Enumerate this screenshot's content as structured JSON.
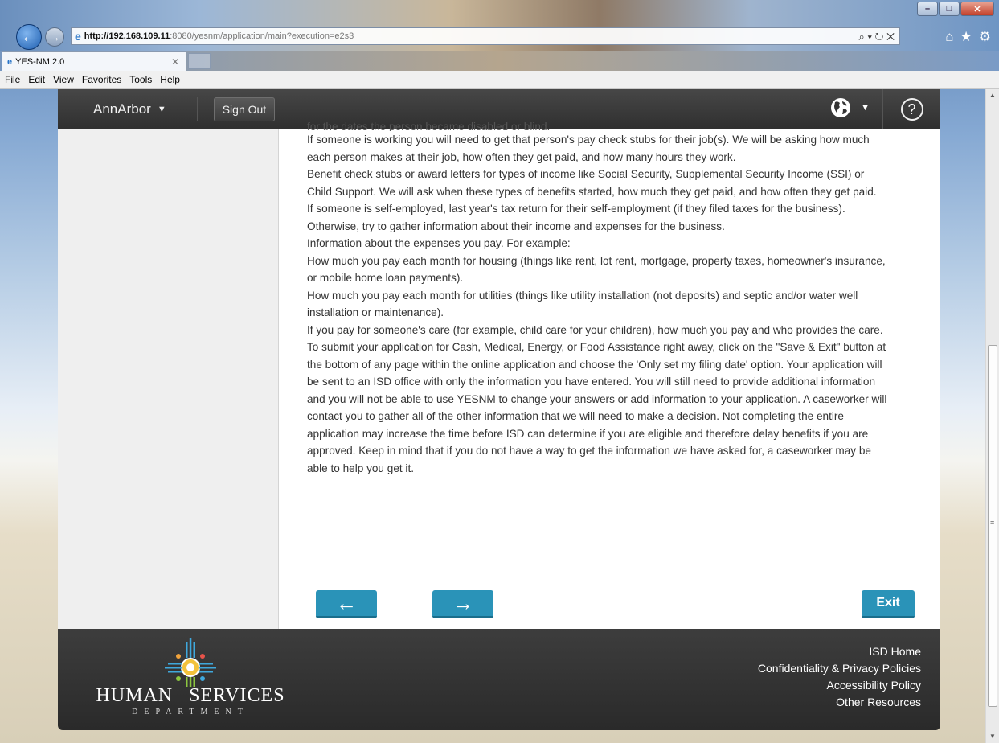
{
  "browser": {
    "url_host": "http://192.168.109.11",
    "url_rest": ":8080/yesnm/application/main?execution=e2s3",
    "tab_title": "YES-NM 2.0",
    "menu": [
      "File",
      "Edit",
      "View",
      "Favorites",
      "Tools",
      "Help"
    ],
    "addr_tools": "⌕ ▾ ↻ ✕",
    "nav_icons": [
      "⌂",
      "★",
      "⚙"
    ]
  },
  "header": {
    "user_name": "AnnArbor",
    "sign_out_label": "Sign Out",
    "help_label": "?"
  },
  "content": {
    "cut_line": "for the dates the person became disabled or blind.",
    "paragraphs": [
      "If someone is working you will need to get that person's pay check stubs for their job(s). We will be asking how much each person makes at their job, how often they get paid, and how many hours they work.",
      "Benefit check stubs or award letters for types of income like Social Security, Supplemental Security Income (SSI) or Child Support. We will ask when these types of benefits started, how much they get paid, and how often they get paid.",
      "If someone is self-employed, last year's tax return for their self-employment (if they filed taxes for the business). Otherwise, try to gather information about their income and expenses for the business.",
      "Information about the expenses you pay. For example:",
      "How much you pay each month for housing (things like rent, lot rent, mortgage, property taxes, homeowner's insurance, or mobile home loan payments).",
      "How much you pay each month for utilities (things like utility installation (not deposits) and septic and/or water well installation or maintenance).",
      "If you pay for someone's care (for example, child care for your children), how much you pay and who provides the care.",
      "To submit your application for Cash, Medical, Energy, or Food Assistance right away, click on the \"Save & Exit\" button at the bottom of any page within the online application and choose the 'Only set my filing date' option. Your application will be sent to an ISD office with only the information you have entered. You will still need to provide additional information and you will not be able to use YESNM to change your answers or add information to your application. A caseworker will contact you to gather all of the other information that we will need to make a decision. Not completing the entire application may increase the time before ISD can determine if you are eligible and therefore delay benefits if you are approved. Keep in mind that if you do not have a way to get the information we have asked for, a caseworker may be able to help you get it."
    ]
  },
  "nav": {
    "prev_label": "←",
    "next_label": "→",
    "exit_label": "Exit"
  },
  "footer": {
    "logo_line1a": "HUMAN",
    "logo_line1b": "SERVICES",
    "logo_line2": "DEPARTMENT",
    "links": [
      "ISD Home",
      "Confidentiality & Privacy Policies",
      "Accessibility Policy",
      "Other Resources"
    ]
  },
  "colors": {
    "accent": "#2a93b8",
    "header_bg": "#3a3a3a",
    "footer_bg": "#333333"
  }
}
